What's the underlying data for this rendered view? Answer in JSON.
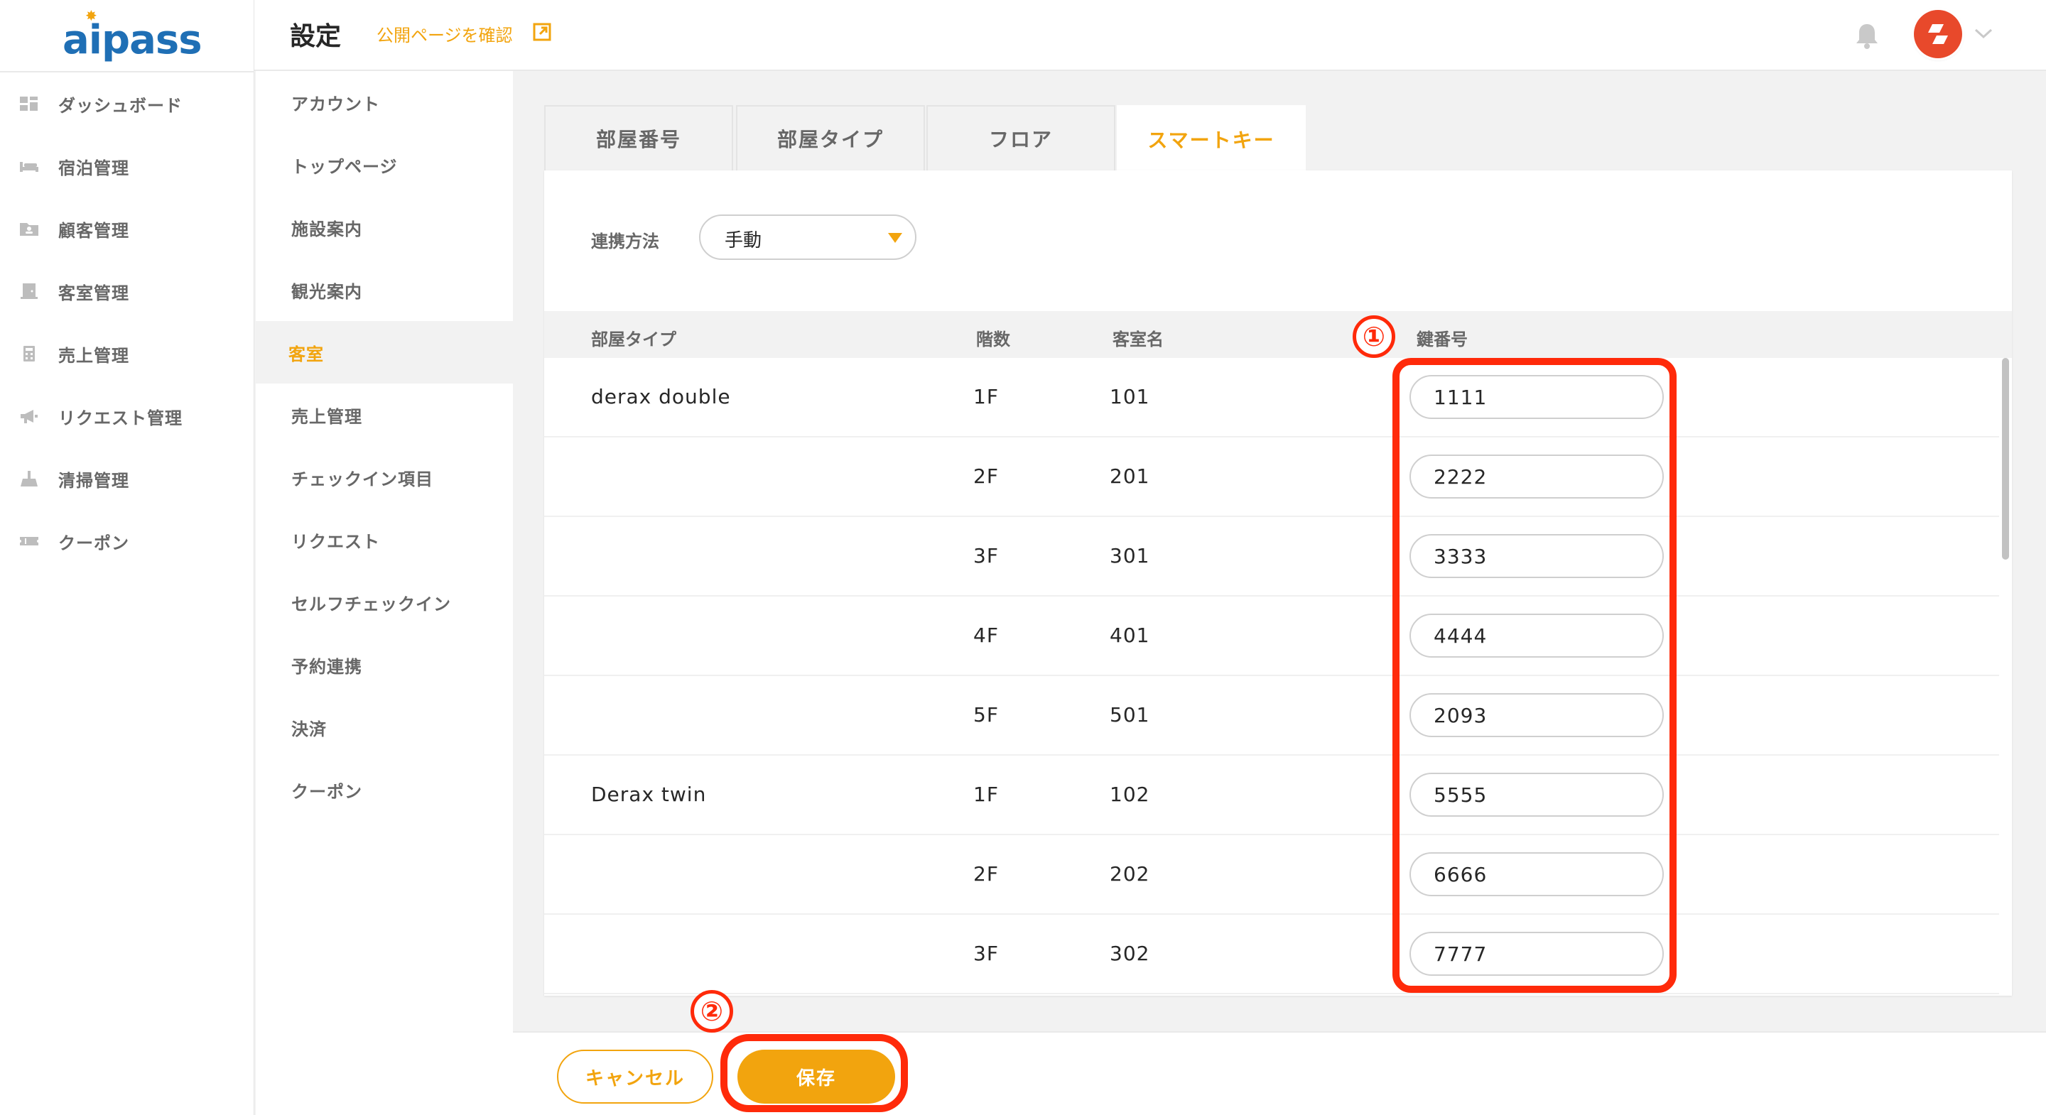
{
  "logo": "aipass",
  "nav": {
    "items": [
      {
        "label": "ダッシュボード",
        "icon": "dashboard-icon"
      },
      {
        "label": "宿泊管理",
        "icon": "bed-icon"
      },
      {
        "label": "顧客管理",
        "icon": "folder-user-icon"
      },
      {
        "label": "客室管理",
        "icon": "door-icon"
      },
      {
        "label": "売上管理",
        "icon": "calculator-icon"
      },
      {
        "label": "リクエスト管理",
        "icon": "megaphone-icon"
      },
      {
        "label": "清掃管理",
        "icon": "broom-icon"
      },
      {
        "label": "クーポン",
        "icon": "ticket-icon"
      }
    ]
  },
  "header": {
    "title": "設定",
    "public_link": "公開ページを確認"
  },
  "settings_nav": {
    "items": [
      {
        "label": "アカウント"
      },
      {
        "label": "トップページ"
      },
      {
        "label": "施設案内"
      },
      {
        "label": "観光案内"
      },
      {
        "label": "客室",
        "active": true
      },
      {
        "label": "売上管理"
      },
      {
        "label": "チェックイン項目"
      },
      {
        "label": "リクエスト"
      },
      {
        "label": "セルフチェックイン"
      },
      {
        "label": "予約連携"
      },
      {
        "label": "決済"
      },
      {
        "label": "クーポン"
      }
    ]
  },
  "tabs": [
    {
      "label": "部屋番号"
    },
    {
      "label": "部屋タイプ"
    },
    {
      "label": "フロア"
    },
    {
      "label": "スマートキー",
      "active": true
    }
  ],
  "sync": {
    "label": "連携方法",
    "value": "手動"
  },
  "table": {
    "headers": {
      "room_type": "部屋タイプ",
      "floor": "階数",
      "room_name": "客室名",
      "key_number": "鍵番号"
    },
    "rows": [
      {
        "room_type": "derax double",
        "floor": "1F",
        "room_name": "101",
        "key": "1111"
      },
      {
        "room_type": "",
        "floor": "2F",
        "room_name": "201",
        "key": "2222"
      },
      {
        "room_type": "",
        "floor": "3F",
        "room_name": "301",
        "key": "3333"
      },
      {
        "room_type": "",
        "floor": "4F",
        "room_name": "401",
        "key": "4444"
      },
      {
        "room_type": "",
        "floor": "5F",
        "room_name": "501",
        "key": "2093"
      },
      {
        "room_type": "Derax twin",
        "floor": "1F",
        "room_name": "102",
        "key": "5555"
      },
      {
        "room_type": "",
        "floor": "2F",
        "room_name": "202",
        "key": "6666"
      },
      {
        "room_type": "",
        "floor": "3F",
        "room_name": "302",
        "key": "7777"
      }
    ]
  },
  "footer": {
    "cancel_label": "キャンセル",
    "save_label": "保存"
  },
  "annotations": [
    "①",
    "②"
  ],
  "colors": {
    "accent": "#f2a40e",
    "annotation": "#ff2a0a",
    "logo": "#1f6fb5"
  }
}
